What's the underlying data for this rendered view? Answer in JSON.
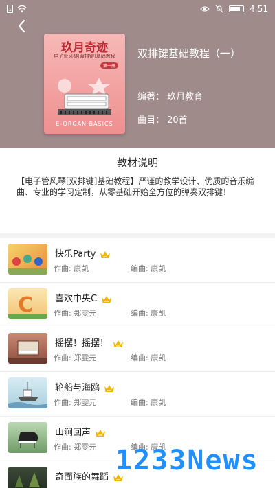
{
  "status": {
    "time": "4:51"
  },
  "book": {
    "cover_title": "玖月奇迹",
    "cover_subtitle": "电子管风琴[双排键]基础教程",
    "cover_volume": "第一册",
    "cover_english": "E-ORGAN BASICS",
    "title": "双排键基础教程（一）",
    "author": "编著：  玖月教育",
    "count": "曲目：  20首"
  },
  "description": {
    "heading": "教材说明",
    "text": "【电子管风琴[双排键]基础教程】严谨的教学设计、优质的音乐编曲、专业的学习定制，从零基础开始全方位的弹奏双排键！"
  },
  "songs": [
    {
      "name": "快乐Party",
      "composer": "作曲:   康凯",
      "arranger": "编曲:   康凯",
      "thumb": "#f0b63a"
    },
    {
      "name": "喜欢中央C",
      "composer": "作曲:   郑雯元",
      "arranger": "编曲:   康凯",
      "thumb": "#e5c37a"
    },
    {
      "name": "摇摆！摇摆！",
      "composer": "作曲:   郑雯元",
      "arranger": "编曲:   康凯",
      "thumb": "#b06a5a"
    },
    {
      "name": "轮船与海鸥",
      "composer": "作曲:   郑雯元",
      "arranger": "编曲:   康凯",
      "thumb": "#9ec6d6"
    },
    {
      "name": "山涧回声",
      "composer": "作曲:   郑雯元",
      "arranger": "编曲:   康凯",
      "thumb": "#7fa877"
    },
    {
      "name": "奇面族的舞蹈",
      "composer": "",
      "arranger": "",
      "thumb": "#2f3b2c"
    }
  ],
  "watermark": "1233News",
  "colors": {
    "header_bg": "#a08b8b",
    "vip_gold": "#f2b705"
  }
}
